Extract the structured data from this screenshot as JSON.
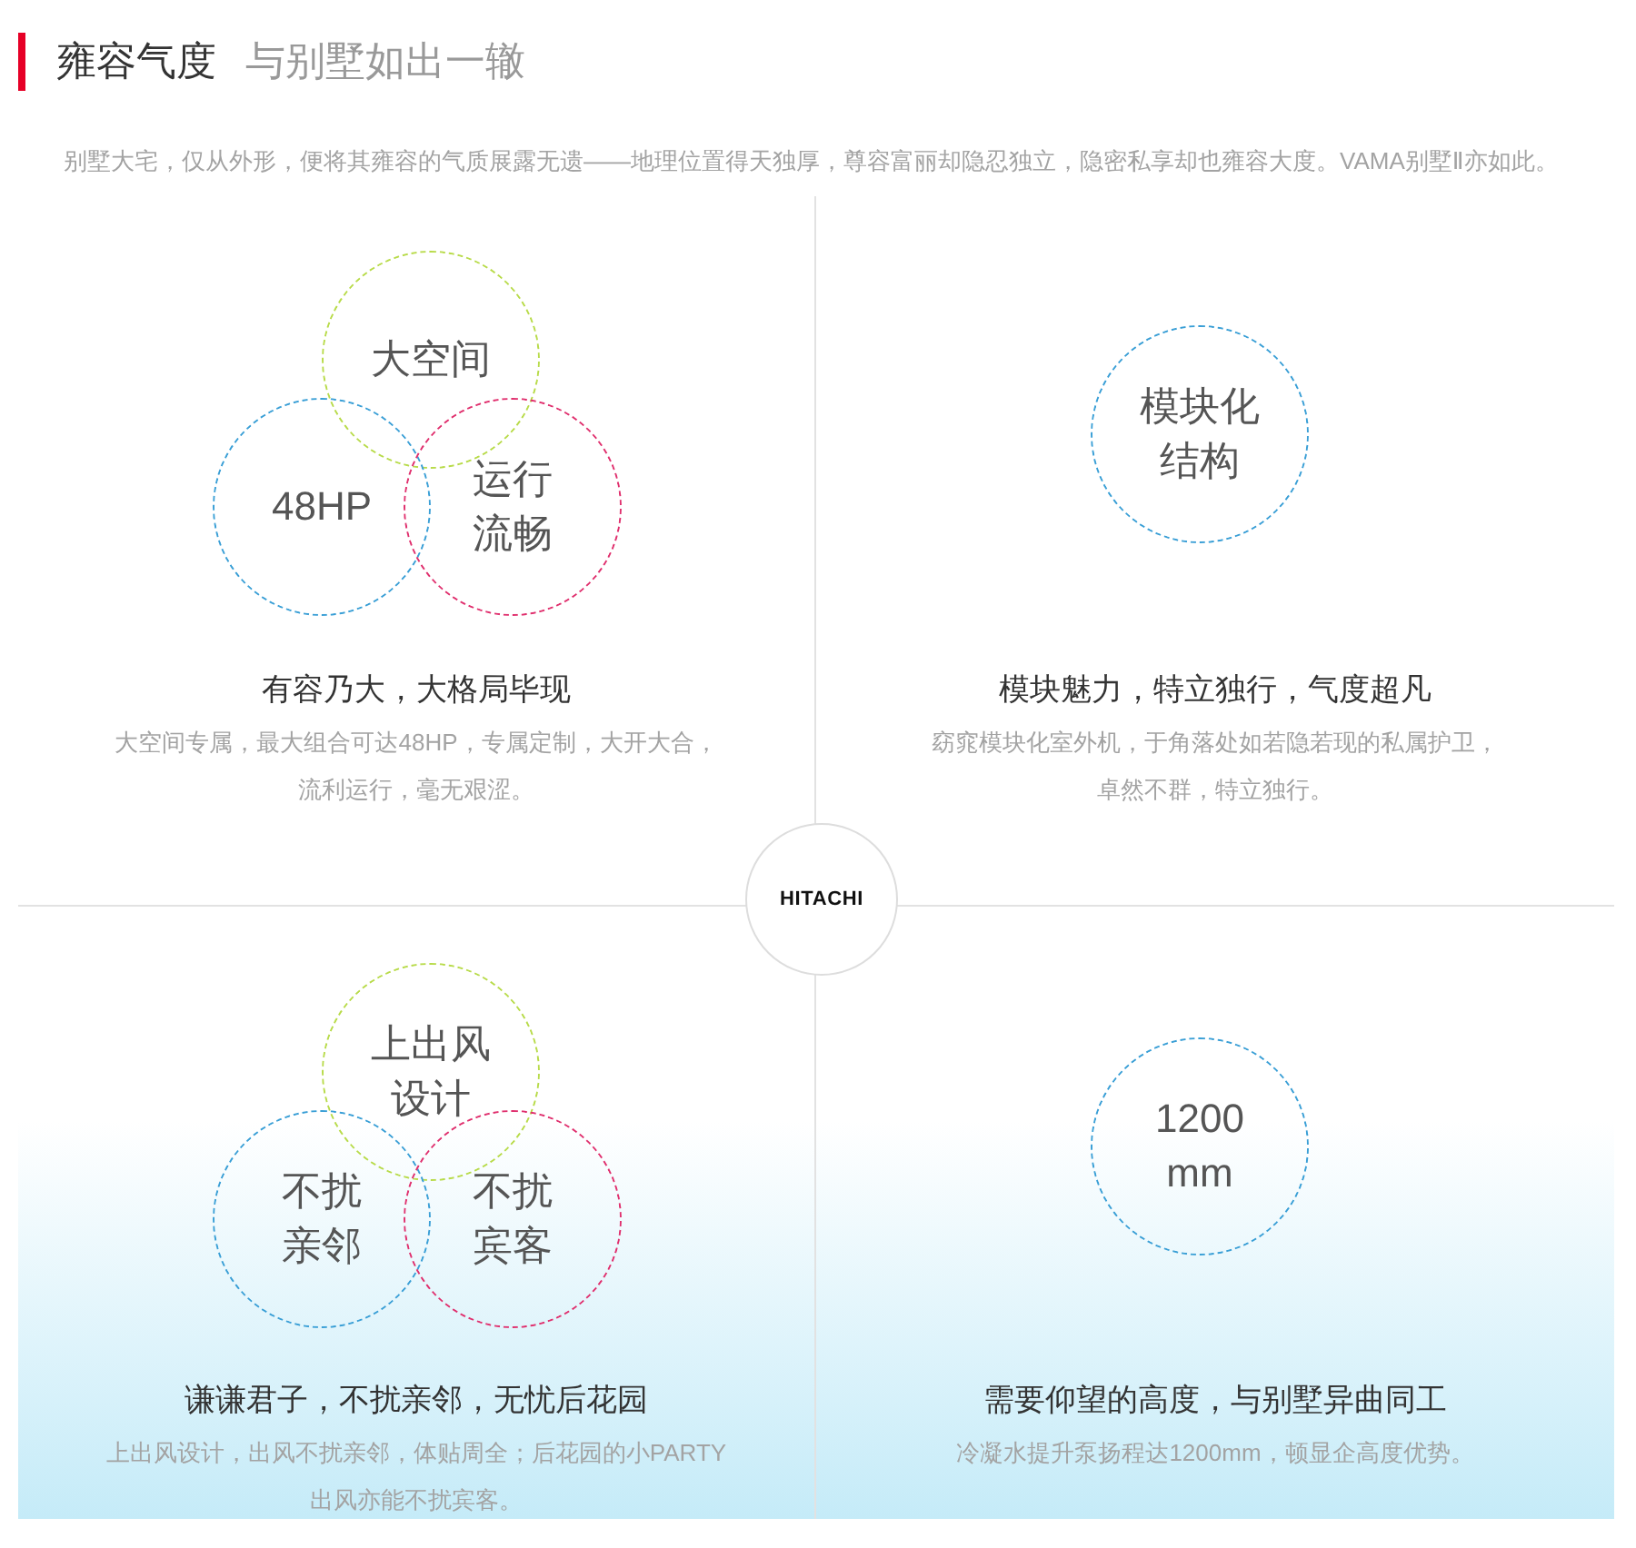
{
  "header": {
    "title": "雍容气度",
    "subtitle": "与别墅如出一辙"
  },
  "intro": "别墅大宅，仅从外形，便将其雍容的气质展露无遗——地理位置得天独厚，尊容富丽却隐忍独立，隐密私享却也雍容大度。VAMA别墅Ⅱ亦如此。",
  "logo": "HITACHI",
  "features": [
    {
      "kind": "venn",
      "circles": [
        {
          "lines": [
            "大空间"
          ],
          "color": "#b8db4a"
        },
        {
          "lines": [
            "48HP"
          ],
          "color": "#3a9fd6"
        },
        {
          "lines": [
            "运行",
            "流畅"
          ],
          "color": "#e0306e"
        }
      ],
      "title": "有容乃大，大格局毕现",
      "description": [
        "大空间专属，最大组合可达48HP，专属定制，大开大合，",
        "流利运行，毫无艰涩。"
      ]
    },
    {
      "kind": "single",
      "circles": [
        {
          "lines": [
            "模块化",
            "结构"
          ],
          "color": "#3a9fd6"
        }
      ],
      "title": "模块魅力，特立独行，气度超凡",
      "description": [
        "窈窕模块化室外机，于角落处如若隐若现的私属护卫，",
        "卓然不群，特立独行。"
      ]
    },
    {
      "kind": "venn",
      "circles": [
        {
          "lines": [
            "上出风",
            "设计"
          ],
          "color": "#b8db4a"
        },
        {
          "lines": [
            "不扰",
            "亲邻"
          ],
          "color": "#3a9fd6"
        },
        {
          "lines": [
            "不扰",
            "宾客"
          ],
          "color": "#e0306e"
        }
      ],
      "title": "谦谦君子，不扰亲邻，无忧后花园",
      "description": [
        "上出风设计，出风不扰亲邻，体贴周全；后花园的小PARTY",
        "出风亦能不扰宾客。"
      ]
    },
    {
      "kind": "single",
      "circles": [
        {
          "lines": [
            "1200",
            "mm"
          ],
          "color": "#3a9fd6"
        }
      ],
      "title": "需要仰望的高度，与别墅异曲同工",
      "description": [
        "冷凝水提升泵扬程达1200mm，顿显企高度优势。"
      ]
    }
  ]
}
